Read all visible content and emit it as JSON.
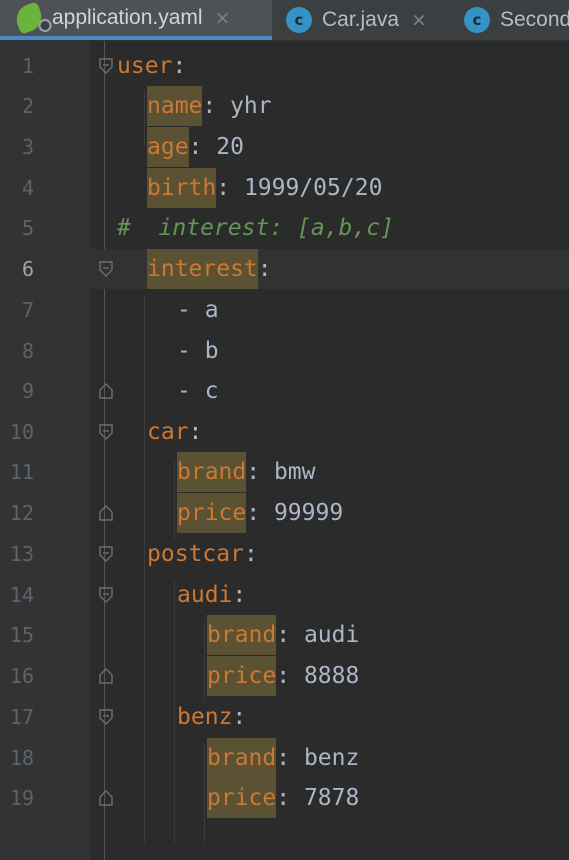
{
  "tabs": [
    {
      "icon": "spring-yaml-icon",
      "label": "application.yaml",
      "active": true
    },
    {
      "icon": "class-icon",
      "icon_glyph": "c",
      "label": "Car.java",
      "active": false
    },
    {
      "icon": "class-icon",
      "icon_glyph": "c",
      "label": "Second",
      "active": false
    }
  ],
  "close_glyph": "×",
  "editor": {
    "current_line": 6,
    "lines": [
      {
        "n": "1",
        "parts": [
          {
            "t": "user",
            "c": "key"
          },
          {
            "t": ":"
          }
        ]
      },
      {
        "n": "2",
        "parts": [
          {
            "t": "name",
            "c": "key hl"
          },
          {
            "t": ": yhr"
          }
        ]
      },
      {
        "n": "3",
        "parts": [
          {
            "t": "age",
            "c": "key hl"
          },
          {
            "t": ": 20"
          }
        ]
      },
      {
        "n": "4",
        "parts": [
          {
            "t": "birth",
            "c": "key hl"
          },
          {
            "t": ": 1999/05/20"
          }
        ]
      },
      {
        "n": "5",
        "parts": [
          {
            "t": "#  interest: [a,b,c]",
            "c": "comment"
          }
        ]
      },
      {
        "n": "6",
        "parts": [
          {
            "t": "interest",
            "c": "key hl"
          },
          {
            "t": ":"
          }
        ]
      },
      {
        "n": "7",
        "parts": [
          {
            "t": "- a"
          }
        ]
      },
      {
        "n": "8",
        "parts": [
          {
            "t": "- b"
          }
        ]
      },
      {
        "n": "9",
        "parts": [
          {
            "t": "- c"
          }
        ]
      },
      {
        "n": "10",
        "parts": [
          {
            "t": "car",
            "c": "key"
          },
          {
            "t": ":"
          }
        ]
      },
      {
        "n": "11",
        "parts": [
          {
            "t": "brand",
            "c": "key hl"
          },
          {
            "t": ": bmw"
          }
        ]
      },
      {
        "n": "12",
        "parts": [
          {
            "t": "price",
            "c": "key hl"
          },
          {
            "t": ": 99999"
          }
        ]
      },
      {
        "n": "13",
        "parts": [
          {
            "t": "postcar",
            "c": "key"
          },
          {
            "t": ":"
          }
        ]
      },
      {
        "n": "14",
        "parts": [
          {
            "t": "audi",
            "c": "key"
          },
          {
            "t": ":"
          }
        ]
      },
      {
        "n": "15",
        "parts": [
          {
            "t": "brand",
            "c": "key hl"
          },
          {
            "t": ": audi"
          }
        ]
      },
      {
        "n": "16",
        "parts": [
          {
            "t": "price",
            "c": "key hl"
          },
          {
            "t": ": 8888"
          }
        ]
      },
      {
        "n": "17",
        "parts": [
          {
            "t": "benz",
            "c": "key"
          },
          {
            "t": ":"
          }
        ]
      },
      {
        "n": "18",
        "parts": [
          {
            "t": "brand",
            "c": "key hl"
          },
          {
            "t": ": benz"
          }
        ]
      },
      {
        "n": "19",
        "parts": [
          {
            "t": "price",
            "c": "key hl"
          },
          {
            "t": ": 7878"
          }
        ]
      }
    ]
  },
  "colors": {
    "background": "#2b2b2b",
    "key": "#cc7832",
    "value": "#a9b7c6",
    "comment": "#629755",
    "key_highlight": "#5a5233",
    "active_tab_underline": "#4a88c7"
  }
}
